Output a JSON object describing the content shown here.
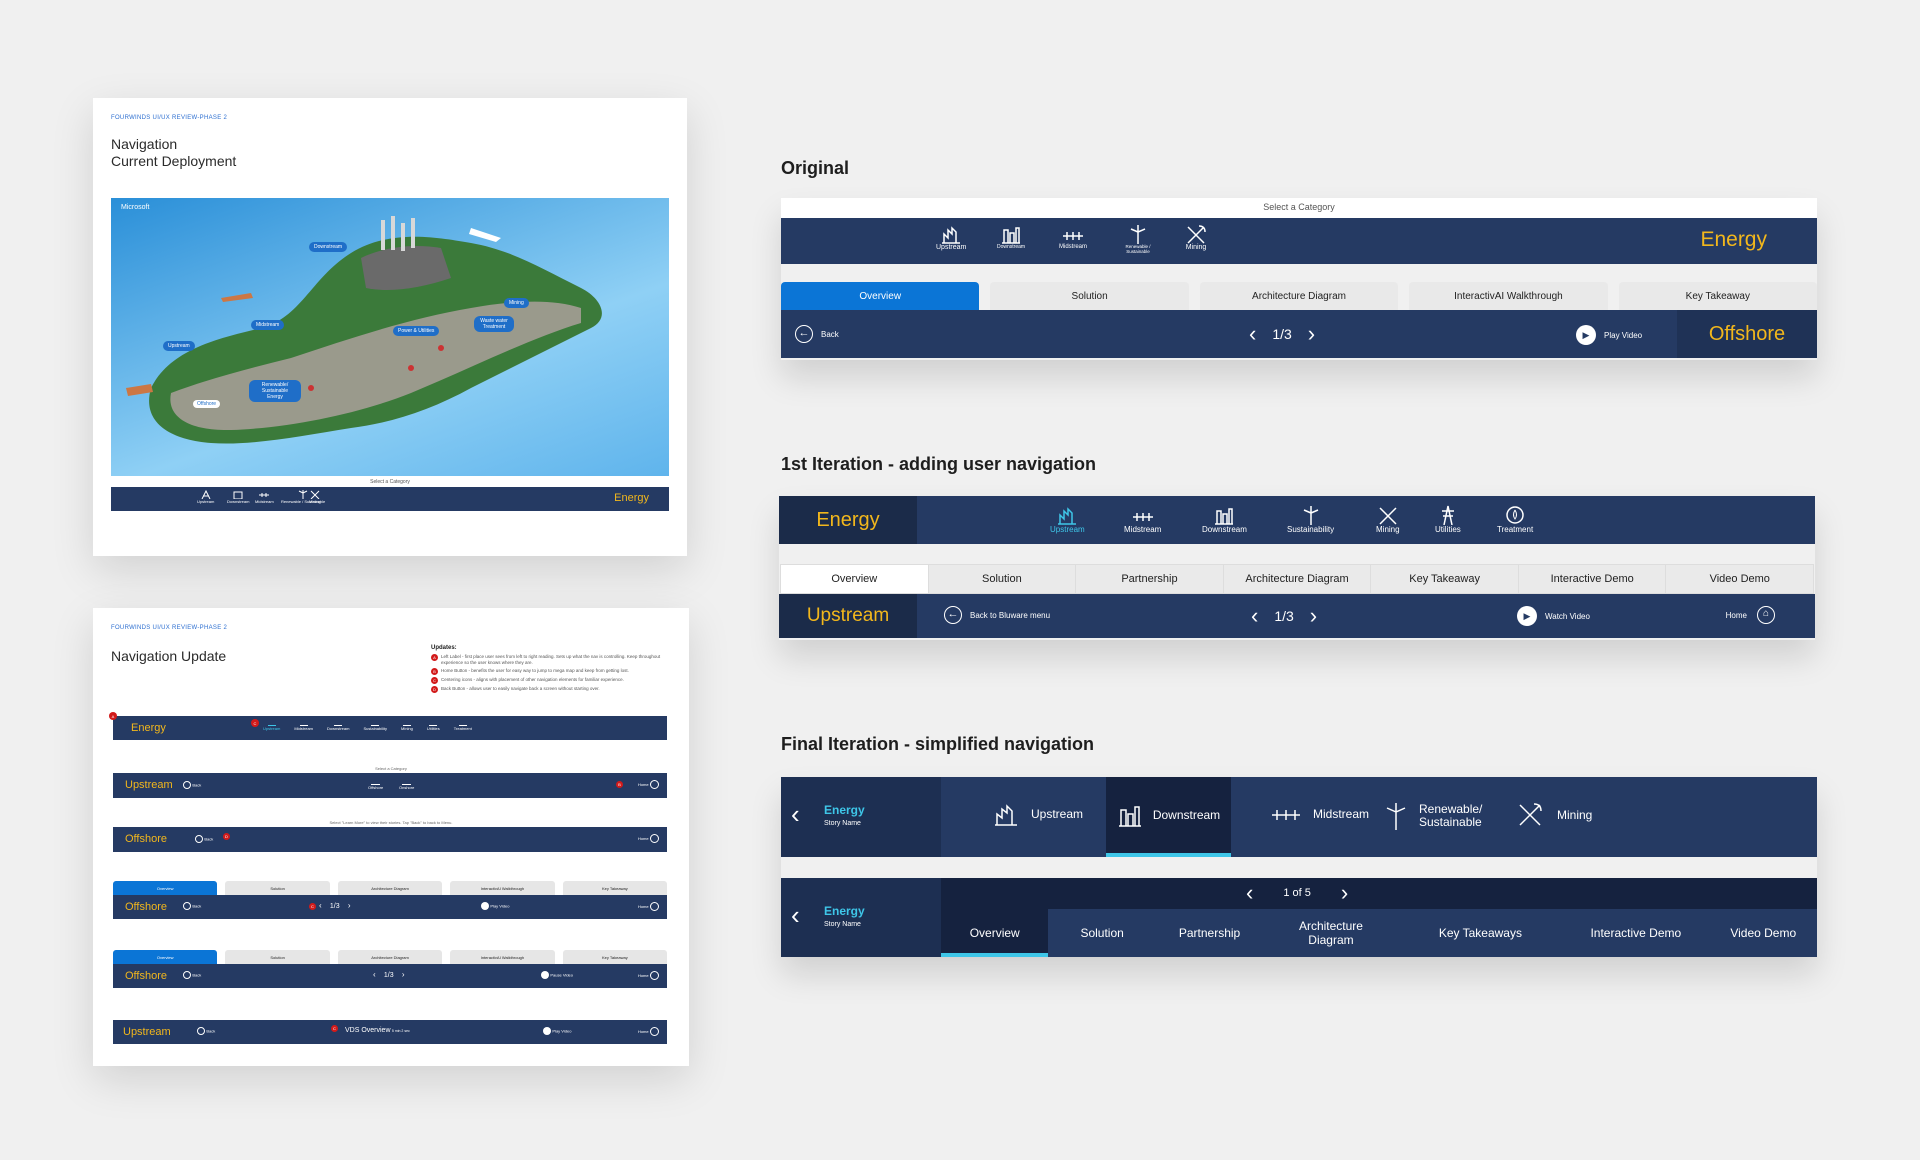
{
  "card1": {
    "kicker": "FOURWINDS UI/UX REVIEW-PHASE 2",
    "title_line1": "Navigation",
    "title_line2": "Current Deployment",
    "map": {
      "brand": "Microsoft",
      "labels": [
        "Downstream",
        "Midstream",
        "Mining",
        "Power & Utilities",
        "Waste water Treatment",
        "Upstream",
        "Renewable/ Sustainable Energy",
        "Offshore"
      ]
    },
    "select_category": "Select a Category",
    "nav_items": [
      "Upstream",
      "Downstream",
      "Midstream",
      "Renewable / Sustainable",
      "Mining"
    ],
    "brand": "Energy"
  },
  "card2": {
    "kicker": "FOURWINDS UI/UX REVIEW-PHASE 2",
    "title": "Navigation Update",
    "updates_title": "Updates:",
    "updates": [
      {
        "badge": "A",
        "text": "Left Label - first place user sees from left to right reading. Sets up what the nav is controlling. Keep throughout experience so the user knows where they are."
      },
      {
        "badge": "B",
        "text": "Home Button - benefits the user for easy way to jump to mega map and keep from getting lost."
      },
      {
        "badge": "C",
        "text": "Centering icons - aligns with placement of other navigation elements for familiar experience."
      },
      {
        "badge": "D",
        "text": "Back Button - allows user to easily navigate back a screen without starting over."
      }
    ],
    "bar1": {
      "left": "Energy",
      "items": [
        "Upstream",
        "Midstream",
        "Downstream",
        "Sustainability",
        "Mining",
        "Utilities",
        "Treatment"
      ]
    },
    "bar2": {
      "caption": "Select a Category",
      "left": "Upstream",
      "back": "Back",
      "items": [
        "Offshore",
        "Onshore"
      ],
      "home": "Home"
    },
    "bar3": {
      "caption": "Select \"Learn More\" to view their stories. Tap \"Back\" to back to Menu.",
      "left": "Offshore",
      "back": "Back",
      "home": "Home"
    },
    "bar4": {
      "tabs": [
        "Overview",
        "Solution",
        "Architecture Diagram",
        "InteractivAI Walkthrough",
        "Key Takeaway"
      ],
      "left": "Offshore",
      "back": "Back",
      "pager": "1/3",
      "video": "Play Video",
      "home": "Home"
    },
    "bar5": {
      "tabs": [
        "Overview",
        "Solution",
        "Architecture Diagram",
        "InteractivAI Walkthrough",
        "Key Takeaway"
      ],
      "left": "Offshore",
      "back": "Back",
      "pager": "1/3",
      "video": "Pause Video",
      "home": "Home"
    },
    "bar6": {
      "left": "Upstream",
      "back": "Back",
      "title": "VDS Overview",
      "duration": "5 min 2 sec",
      "video": "Play Video",
      "home": "Home"
    }
  },
  "original": {
    "heading": "Original",
    "select_category": "Select a Category",
    "items": [
      "Upstream",
      "Downstream",
      "Midstream",
      "Renewable / Sustainable",
      "Mining"
    ],
    "brand": "Energy",
    "tabs": [
      "Overview",
      "Solution",
      "Architecture Diagram",
      "InteractivAI Walkthrough",
      "Key Takeaway"
    ],
    "back": "Back",
    "pager": "1/3",
    "video": "Play Video",
    "right_label": "Offshore"
  },
  "first": {
    "heading": "1st Iteration - adding user navigation",
    "brand": "Energy",
    "items": [
      "Upstream",
      "Midstream",
      "Downstream",
      "Sustainability",
      "Mining",
      "Utilities",
      "Treatment"
    ],
    "tabs": [
      "Overview",
      "Solution",
      "Partnership",
      "Architecture Diagram",
      "Key Takeaway",
      "Interactive Demo",
      "Video Demo"
    ],
    "left": "Upstream",
    "back": "Back to Bluware menu",
    "pager": "1/3",
    "video": "Watch Video",
    "home": "Home"
  },
  "final": {
    "heading": "Final Iteration - simplified navigation",
    "brand": "Energy",
    "story": "Story Name",
    "items": [
      "Upstream",
      "Downstream",
      "Midstream",
      "Renewable/ Sustainable",
      "Mining"
    ],
    "pager": "1 of 5",
    "tabs": [
      "Overview",
      "Solution",
      "Partnership",
      "Architecture Diagram",
      "Key Takeaways",
      "Interactive Demo",
      "Video Demo"
    ]
  },
  "colors": {
    "navy": "#253a63",
    "gold": "#f2b71c",
    "blue_tab": "#0b75d6",
    "cyan": "#3ec6e8"
  }
}
